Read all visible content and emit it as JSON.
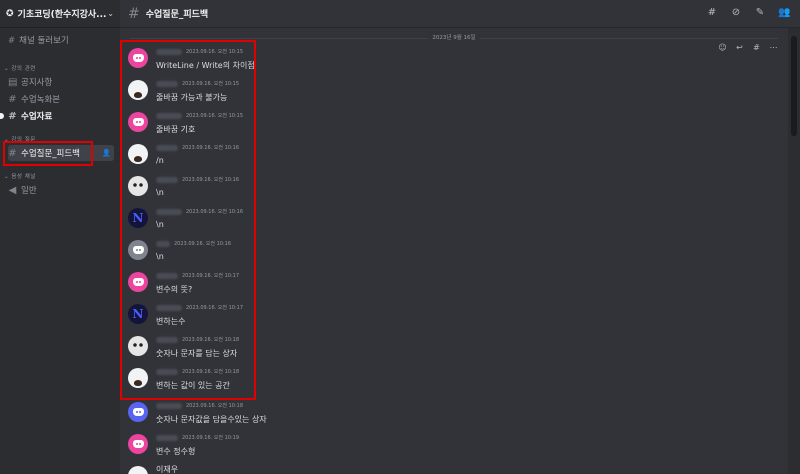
{
  "server": {
    "name": "기초코딩(한수지강사...",
    "icon": "discord-logo-icon",
    "menu_icon": "chevron-down-icon"
  },
  "sidebar": {
    "browse_channels": "채널 둘러보기",
    "categories": [
      {
        "label": "강의 관련",
        "channels": [
          {
            "name": "공지사항",
            "icon": "announcement-icon",
            "state": "normal"
          },
          {
            "name": "수업녹화본",
            "icon": "hash-icon",
            "state": "normal"
          },
          {
            "name": "수업자료",
            "icon": "hash-icon",
            "state": "unread"
          }
        ]
      },
      {
        "label": "강의 질문",
        "channels": [
          {
            "name": "수업질문_피드백",
            "icon": "hash-icon",
            "state": "selected"
          }
        ]
      },
      {
        "label": "음성 채널",
        "channels": [
          {
            "name": "일반",
            "icon": "speaker-icon",
            "state": "normal"
          }
        ]
      }
    ]
  },
  "topbar": {
    "channel_name": "수업질문_피드백",
    "icons": [
      "threads-icon",
      "notification-muted-icon",
      "pin-icon",
      "members-icon"
    ]
  },
  "date_divider": "2023년 9월 16일",
  "hover_actions": [
    "add-reaction-icon",
    "reply-icon",
    "thread-icon",
    "more-icon"
  ],
  "messages": [
    {
      "avatar": "discord-pink",
      "timestamp": "2023.09.16. 오전 10:15",
      "text": "WriteLine / Write의 차이점"
    },
    {
      "avatar": "cat",
      "timestamp": "2023.09.16. 오전 10:15",
      "text": "줄바꿈 가능과 불가능"
    },
    {
      "avatar": "discord-pink",
      "timestamp": "2023.09.16. 오전 10:15",
      "text": "줄바꿈 기호"
    },
    {
      "avatar": "cat",
      "timestamp": "2023.09.16. 오전 10:16",
      "text": "/n"
    },
    {
      "avatar": "white",
      "timestamp": "2023.09.16. 오전 10:16",
      "text": "\\n"
    },
    {
      "avatar": "n",
      "timestamp": "2023.09.16. 오전 10:16",
      "text": "\\n"
    },
    {
      "avatar": "discord-gray",
      "timestamp": "2023.09.16. 오전 10:16",
      "text": "\\n"
    },
    {
      "avatar": "discord-pink",
      "timestamp": "2023.09.16. 오전 10:17",
      "text": "변수의 뜻?"
    },
    {
      "avatar": "n",
      "timestamp": "2023.09.16. 오전 10:17",
      "text": "변하는수"
    },
    {
      "avatar": "white",
      "timestamp": "2023.09.16. 오전 10:18",
      "text": "숫자나 문자를 담는 상자"
    },
    {
      "avatar": "cat",
      "timestamp": "2023.09.16. 오전 10:18",
      "text": "변하는 값이 있는 공간"
    },
    {
      "avatar": "discord-blurple",
      "timestamp": "2023.09.16. 오전 10:18",
      "text": "숫자나 문자값을 담을수있는 상자"
    },
    {
      "avatar": "discord-pink",
      "timestamp": "2023.09.16. 오전 10:19",
      "text": "변수 정수형"
    },
    {
      "avatar": "cat",
      "timestamp": "",
      "text": "이재우"
    }
  ],
  "colors": {
    "background": "#313338",
    "sidebar": "#2b2d31",
    "highlight_box": "#e00000",
    "discord_pink": "#eb459e",
    "blurple": "#5865f2"
  }
}
